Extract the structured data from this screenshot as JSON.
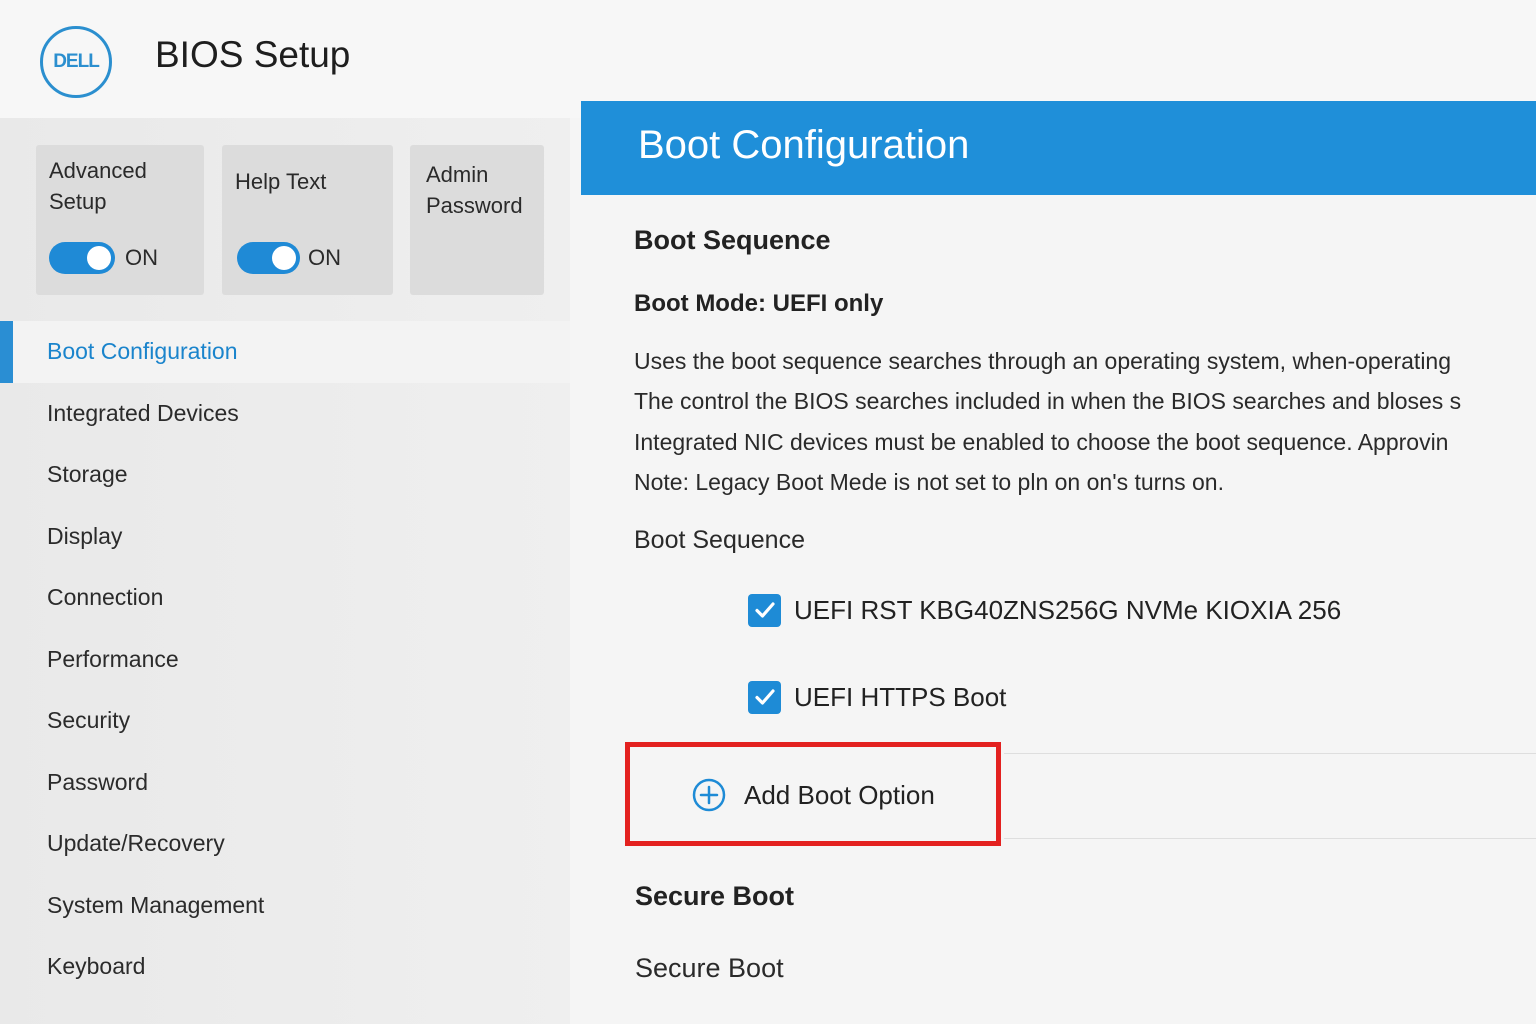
{
  "header": {
    "logo_text": "DELL",
    "title": "BIOS Setup"
  },
  "quick_settings": [
    {
      "label": "Advanced Setup",
      "state": "ON",
      "enabled": true
    },
    {
      "label": "Help Text",
      "state": "ON",
      "enabled": true
    },
    {
      "label": "Admin Password"
    }
  ],
  "sidebar": {
    "items": [
      {
        "label": "Boot Configuration",
        "active": true
      },
      {
        "label": "Integrated Devices"
      },
      {
        "label": "Storage"
      },
      {
        "label": "Display"
      },
      {
        "label": "Connection"
      },
      {
        "label": "Performance"
      },
      {
        "label": "Security"
      },
      {
        "label": "Password"
      },
      {
        "label": "Update/Recovery"
      },
      {
        "label": "System Management"
      },
      {
        "label": "Keyboard"
      }
    ]
  },
  "main": {
    "title": "Boot Configuration",
    "boot_sequence_heading": "Boot Sequence",
    "boot_mode": "Boot Mode: UEFI only",
    "description": [
      "Uses the boot sequence searches through an operating system, when-operating",
      "The control the BIOS searches included in when the BIOS searches and bloses s",
      "Integrated NIC devices must be enabled to choose the boot sequence. Approvin",
      "Note: Legacy Boot Mede is not set to pln on on's turns on."
    ],
    "boot_sequence_label": "Boot Sequence",
    "boot_options": [
      {
        "label": "UEFI RST KBG40ZNS256G NVMe KIOXIA 256",
        "checked": true
      },
      {
        "label": "UEFI HTTPS Boot",
        "checked": true
      }
    ],
    "add_boot_option_label": "Add Boot Option",
    "secure_boot_heading": "Secure Boot",
    "secure_boot_label": "Secure Boot"
  },
  "colors": {
    "accent": "#1f8fd9",
    "toggle_on": "#1f8ad6",
    "highlight_box": "#e3211f",
    "active_nav_text": "#1a84cc"
  },
  "icons": {
    "logo": "dell-logo",
    "checkbox": "checkmark-icon",
    "add": "plus-circle-icon"
  }
}
